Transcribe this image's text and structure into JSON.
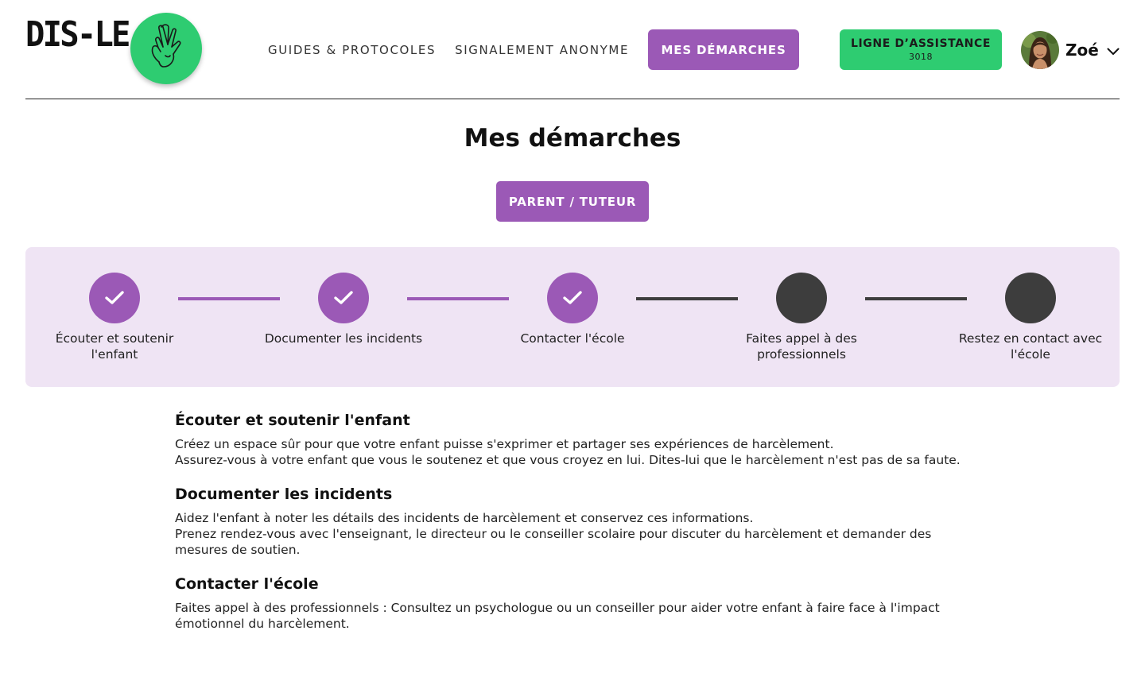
{
  "brand": {
    "name": "DIS-LE",
    "green": "#2ecc71",
    "purple": "#9b59b6"
  },
  "nav": {
    "guides": "GUIDES & PROTOCOLES",
    "signalement": "SIGNALEMENT ANONYME",
    "demarches": "MES DÉMARCHES",
    "assistance": {
      "label": "LIGNE D’ASSISTANCE",
      "number": "3018"
    }
  },
  "user": {
    "name": "Zoé",
    "menu_icon": "chevron-down-icon"
  },
  "page": {
    "title": "Mes démarches",
    "role": "PARENT / TUTEUR"
  },
  "steps": [
    {
      "label": "Écouter et soutenir l'enfant",
      "status": "done"
    },
    {
      "label": "Documenter les incidents",
      "status": "done"
    },
    {
      "label": "Contacter l'école",
      "status": "done"
    },
    {
      "label": "Faites appel à des professionnels",
      "status": "todo"
    },
    {
      "label": "Restez en contact avec l'école",
      "status": "todo"
    }
  ],
  "sections": [
    {
      "title": "Écouter et soutenir l'enfant",
      "lines": [
        "Créez un espace sûr pour que votre enfant puisse s'exprimer et partager ses expériences de harcèlement.",
        "Assurez-vous à votre enfant que vous le soutenez et que vous croyez en lui. Dites-lui que le harcèlement n'est pas de sa faute."
      ]
    },
    {
      "title": "Documenter les incidents",
      "lines": [
        "Aidez l'enfant à noter les détails des incidents de harcèlement et conservez ces informations.",
        "Prenez rendez-vous avec l'enseignant, le directeur ou le conseiller scolaire pour discuter du harcèlement et demander des mesures de soutien."
      ]
    },
    {
      "title": "Contacter l'école",
      "lines": [
        "Faites appel à des professionnels : Consultez un psychologue ou un conseiller pour aider votre enfant à faire face à l'impact émotionnel du harcèlement."
      ]
    }
  ]
}
